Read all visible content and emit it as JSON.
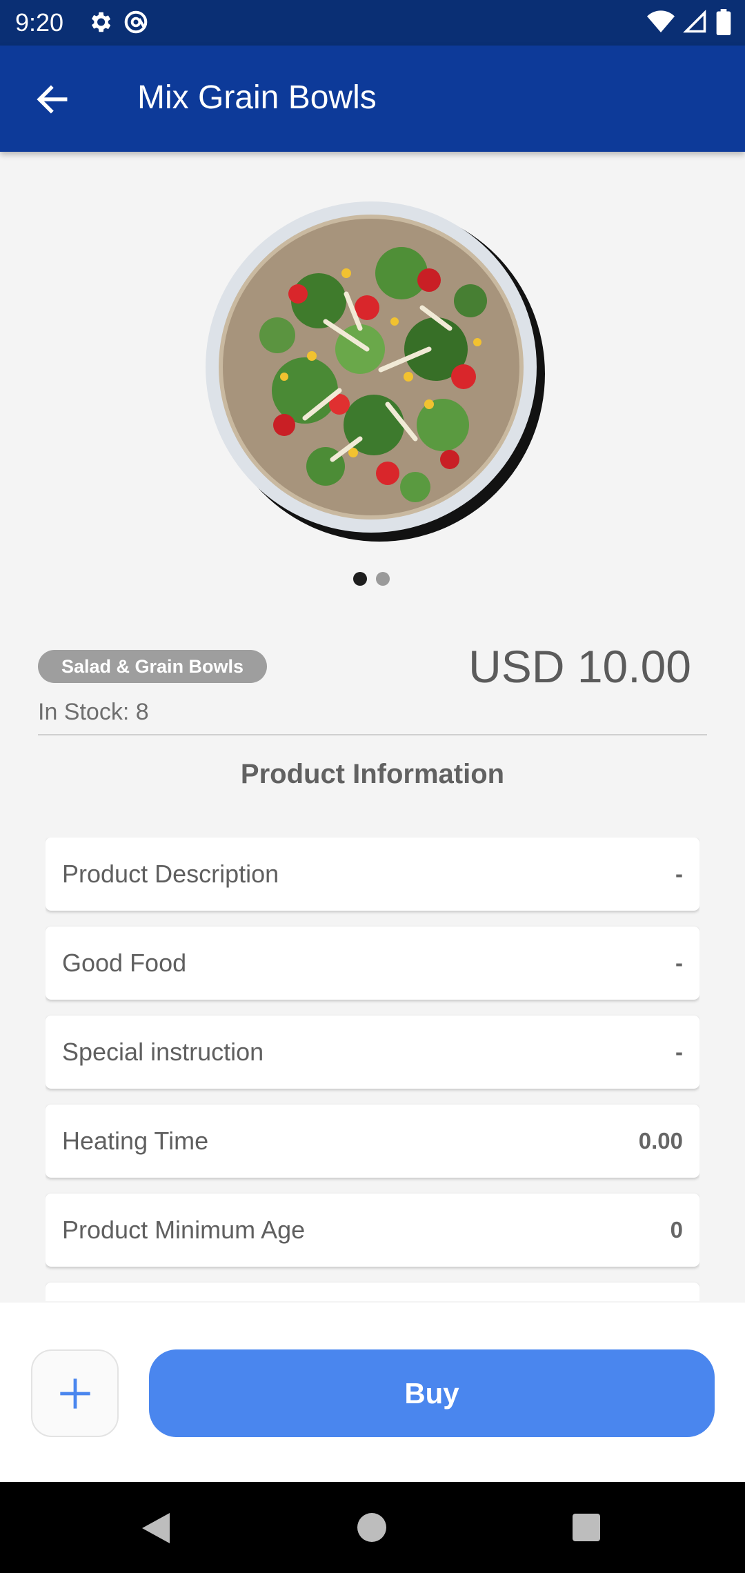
{
  "status_bar": {
    "time": "9:20"
  },
  "app_bar": {
    "title": "Mix Grain Bowls"
  },
  "carousel": {
    "current": 1,
    "total": 2
  },
  "product": {
    "category": "Salad & Grain Bowls",
    "price": "USD 10.00",
    "stock": "In Stock: 8"
  },
  "section": {
    "title": "Product Information"
  },
  "info_items": [
    {
      "label": "Product Description",
      "value": "-"
    },
    {
      "label": "Good Food",
      "value": "-"
    },
    {
      "label": "Special instruction",
      "value": "-"
    },
    {
      "label": "Heating Time",
      "value": "0.00"
    },
    {
      "label": "Product Minimum Age",
      "value": "0"
    },
    {
      "label": "",
      "value": ""
    }
  ],
  "actions": {
    "buy_label": "Buy"
  },
  "colors": {
    "app_bar": "#0d3a99",
    "status_bar": "#0a2f74",
    "buy_button": "#4a86ee",
    "chip": "#9e9e9e"
  }
}
